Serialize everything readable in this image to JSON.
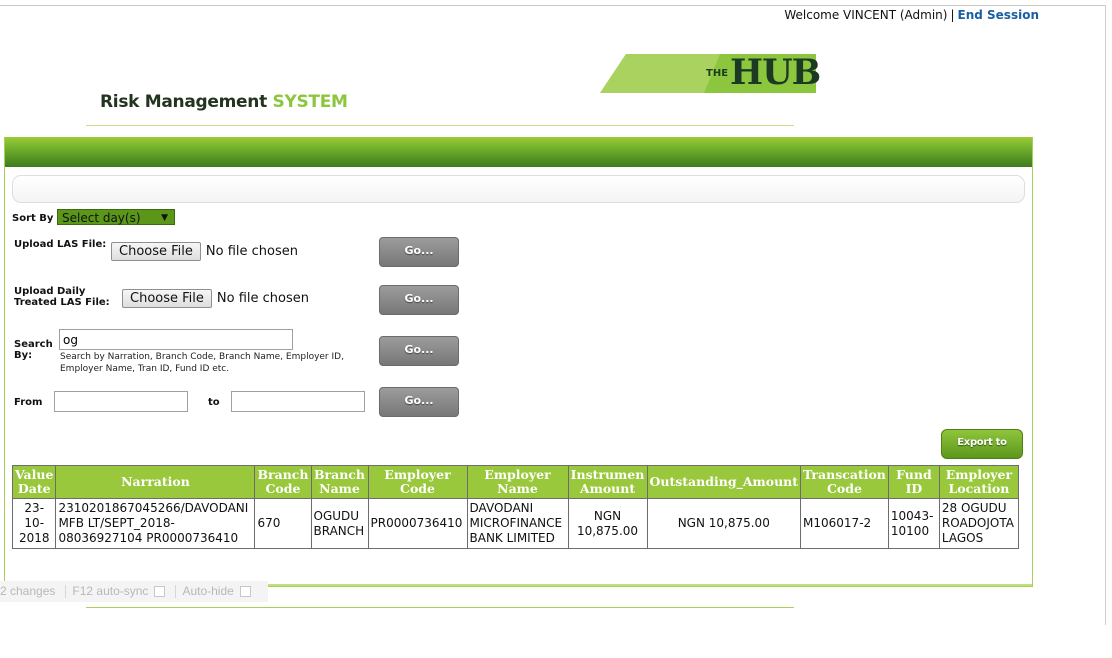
{
  "header": {
    "welcome_text": "Welcome VINCENT (Admin)",
    "separator": "|",
    "end_session_label": "End Session",
    "logo_the": "THE",
    "logo_hub": "HUB",
    "app_title_main": "Risk Management",
    "app_title_accent": "SYSTEM"
  },
  "controls": {
    "sort_by_label": "Sort By",
    "sort_select_value": "Select day(s)",
    "upload_las_label": "Upload LAS File:",
    "upload_daily_label_line1": "Upload Daily",
    "upload_daily_label_line2": "Treated LAS File:",
    "choose_file_label": "Choose File",
    "no_file_text": "No file chosen",
    "go_label": "Go...",
    "search_label_line1": "Search",
    "search_label_line2": "By:",
    "search_value": "og",
    "search_hint": "Search by Narration, Branch Code, Branch Name, Employer ID, Employer Name, Tran ID, Fund ID etc.",
    "from_label": "From",
    "to_label": "to",
    "export_label": "Export to Excel"
  },
  "table": {
    "headers": [
      "Value Date",
      "Narration",
      "Branch Code",
      "Branch Name",
      "Employer Code",
      "Employer Name",
      "Instrumen Amount",
      "Outstanding_Amount",
      "Transcation Code",
      "Fund ID",
      "Employer Location"
    ],
    "rows": [
      [
        "23-10-2018",
        "2310201867045266/DAVODANI MFB LT/SEPT_2018-08036927104 PR0000736410",
        "670",
        "OGUDU BRANCH",
        "PR0000736410",
        "DAVODANI MICROFINANCE BANK LIMITED",
        "NGN 10,875.00",
        "NGN 10,875.00",
        "M106017-2",
        "10043-10100",
        "28 OGUDU ROADOJOTA LAGOS"
      ]
    ]
  },
  "devtools": {
    "changes": "2 changes",
    "auto_sync": "F12 auto-sync",
    "auto_hide": "Auto-hide"
  },
  "colors": {
    "accent_green": "#8cc63f",
    "header_dark_green": "#3f7b1f",
    "link_blue": "#1a5ea3",
    "go_button_gray": "#8a8a8a"
  }
}
